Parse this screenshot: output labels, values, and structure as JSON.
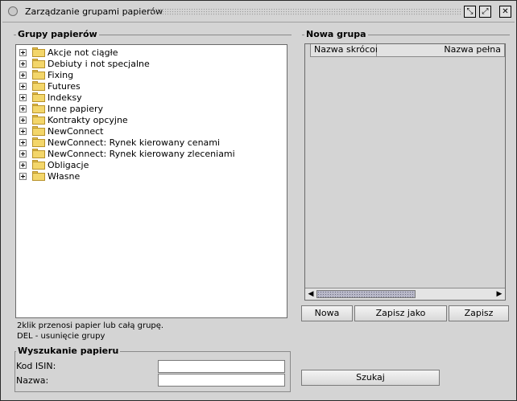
{
  "window": {
    "title": "Zarządzanie grupami papierów",
    "controls": {
      "minimize": "⤡",
      "maximize": "⤢",
      "close": "✕"
    }
  },
  "groups_panel": {
    "title": "Grupy papierów",
    "items": [
      {
        "label": "Akcje not ciągłe",
        "icon": "folder-icon"
      },
      {
        "label": "Debiuty i not specjalne",
        "icon": "folder-icon"
      },
      {
        "label": "Fixing",
        "icon": "folder-icon"
      },
      {
        "label": "Futures",
        "icon": "folder-icon"
      },
      {
        "label": "Indeksy",
        "icon": "folder-icon"
      },
      {
        "label": "Inne papiery",
        "icon": "folder-icon"
      },
      {
        "label": "Kontrakty opcyjne",
        "icon": "folder-icon"
      },
      {
        "label": "NewConnect",
        "icon": "folder-icon"
      },
      {
        "label": "NewConnect: Rynek kierowany cenami",
        "icon": "folder-icon"
      },
      {
        "label": "NewConnect: Rynek kierowany zleceniami",
        "icon": "folder-icon"
      },
      {
        "label": "Obligacje",
        "icon": "folder-icon"
      },
      {
        "label": "Własne",
        "icon": "folder-icon"
      }
    ],
    "hint_line1": "2klik przenosi papier lub całą grupę.",
    "hint_line2": "DEL - usunięcie grupy"
  },
  "new_group_panel": {
    "title": "Nowa grupa",
    "columns": [
      "Nazwa skrócona",
      "Nazwa pełna"
    ],
    "scroll_left": "◀",
    "scroll_right": "▶",
    "buttons": {
      "new": "Nowa",
      "save_as": "Zapisz jako",
      "save": "Zapisz"
    }
  },
  "search_panel": {
    "title": "Wyszukanie papieru",
    "isin_label": "Kod ISIN:",
    "isin_value": "",
    "name_label": "Nazwa:",
    "name_value": "",
    "search_button": "Szukaj"
  }
}
